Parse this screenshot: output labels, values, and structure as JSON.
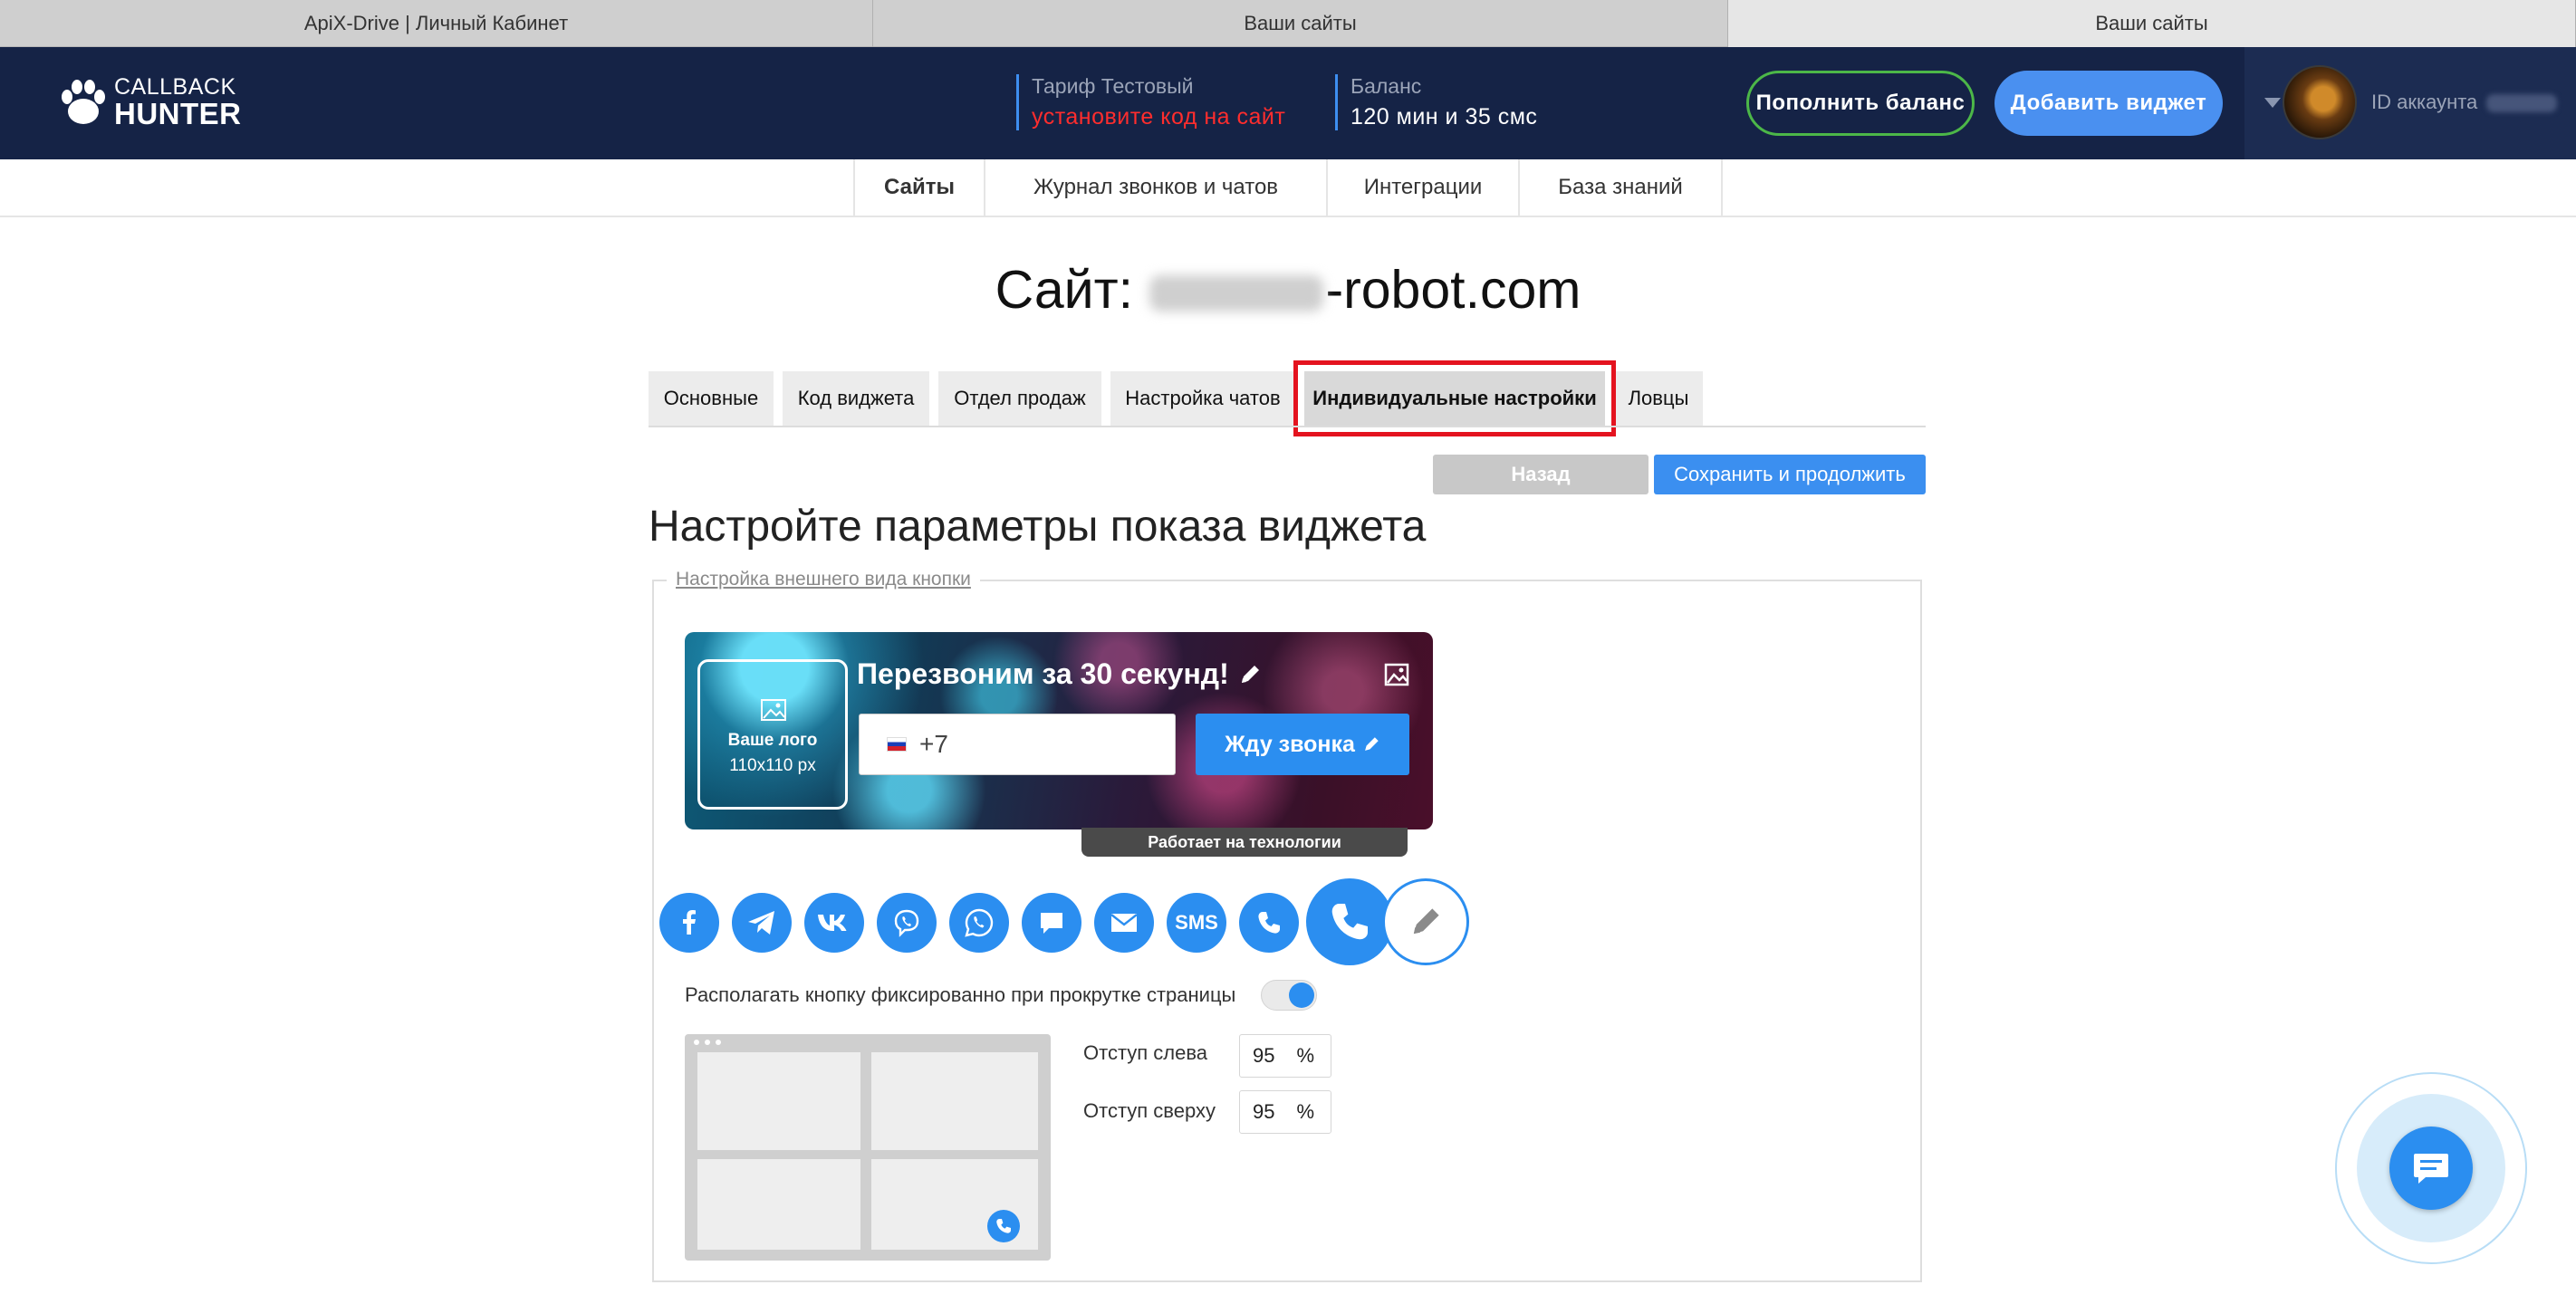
{
  "browser": {
    "tabs": [
      {
        "title": "ApiX-Drive | Личный Кабинет",
        "active": false
      },
      {
        "title": "Ваши сайты",
        "active": false
      },
      {
        "title": "Ваши сайты",
        "active": true
      }
    ]
  },
  "header": {
    "logo_line1": "CALLBACK",
    "logo_line2": "HUNTER",
    "tariff_label": "Тариф Тестовый",
    "tariff_status": "установите код на сайт",
    "balance_label": "Баланс",
    "balance_value": "120 мин и 35 смс",
    "topup_button": "Пополнить баланс",
    "add_widget_button": "Добавить виджет",
    "account_id_label": "ID аккаунта"
  },
  "nav": {
    "items": [
      "Сайты",
      "Журнал звонков и чатов",
      "Интеграции",
      "База знаний"
    ],
    "active": "Сайты"
  },
  "page": {
    "title_prefix": "Сайт:",
    "title_domain_visible": "-robot.com"
  },
  "settings_tabs": {
    "items": [
      "Основные",
      "Код виджета",
      "Отдел продаж",
      "Настройка чатов",
      "Индивидуальные настройки",
      "Ловцы"
    ],
    "active": "Индивидуальные настройки"
  },
  "actions": {
    "back": "Назад",
    "save_continue": "Сохранить и продолжить"
  },
  "section": {
    "heading": "Настройте параметры показа виджета",
    "legend": "Настройка внешнего вида кнопки"
  },
  "widget_preview": {
    "logo_title": "Ваше лого",
    "logo_size": "110x110 px",
    "heading": "Перезвоним за 30 секунд!",
    "phone_prefix": "+7",
    "call_button": "Жду звонка",
    "powered_by": "Работает на технологии"
  },
  "channels": [
    "facebook-icon",
    "telegram-icon",
    "vk-icon",
    "viber-icon",
    "whatsapp-icon",
    "chat-icon",
    "email-icon",
    "sms-icon",
    "phone-icon"
  ],
  "channel_sms_label": "SMS",
  "fixed_position": {
    "label": "Располагать кнопку фиксированно при прокрутке страницы",
    "enabled": true
  },
  "offsets": {
    "left_label": "Отступ слева",
    "left_value": "95",
    "top_label": "Отступ сверху",
    "top_value": "95",
    "unit": "%"
  },
  "colors": {
    "header_bg": "#152346",
    "accent": "#2b8ef0",
    "topup_border": "#4cb748",
    "highlight": "#e4131f",
    "tariff_status": "#ff2d2d"
  }
}
